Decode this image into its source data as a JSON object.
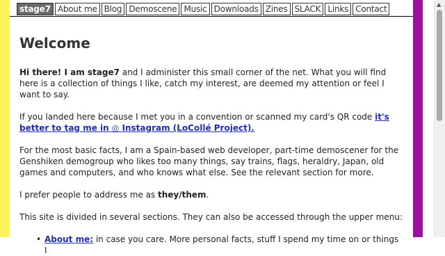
{
  "nav": {
    "tabs": [
      "stage7",
      "About me",
      "Blog",
      "Demoscene",
      "Music",
      "Downloads",
      "Zines",
      "SLACK",
      "Links",
      "Contact"
    ],
    "active_tab": "stage7"
  },
  "page": {
    "title": "Welcome",
    "intro_bold": "Hi there! I am stage7",
    "intro_rest": " and I administer this small corner of the net. What you will find here is a collection of things I like, catch my interest, are deemed my attention or feel I want to say.",
    "qr_text": "If you landed here because I met you in a convention or scanned my card's QR code ",
    "qr_link_pre": "it's better to tag me in ",
    "qr_link_icon": "◎",
    "qr_link_post": " Instagram (LoCollé Project).",
    "facts": "For the most basic facts, I am a Spain-based web developer, part-time demoscener for the Genshiken demogroup who likes too many things, say trains, flags, heraldry, Japan, old games and computers, and who knows what else. See the relevant section for more.",
    "pronoun_pre": "I prefer people to address me as ",
    "pronoun_bold": "they/them",
    "pronoun_post": ".",
    "sections_intro": "This site is divided in several sections. They can also be accessed through the upper menu:",
    "list": [
      {
        "bullet": "•",
        "link": "About me:",
        "text": " in case you care. More personal facts, stuff I spend my time on or things I"
      }
    ]
  },
  "colors": {
    "left_stripe": "#fff35a",
    "right_stripe": "#9b0fa2",
    "link": "#1d2db8",
    "active_tab": "#6b6b6b"
  }
}
